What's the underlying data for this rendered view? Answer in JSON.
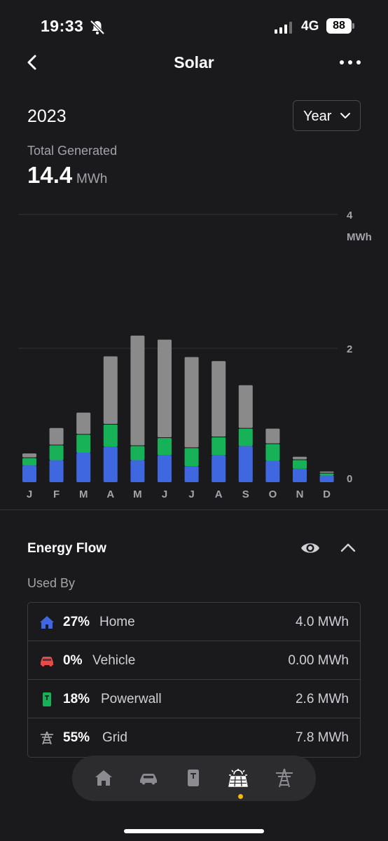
{
  "status_bar": {
    "time": "19:33",
    "network": "4G",
    "battery": "88"
  },
  "header": {
    "title": "Solar"
  },
  "summary": {
    "year": "2023",
    "period_select": "Year",
    "total_label": "Total Generated",
    "total_value": "14.4",
    "total_unit": "MWh"
  },
  "chart_data": {
    "type": "bar",
    "stacked": true,
    "categories": [
      "J",
      "F",
      "M",
      "A",
      "M",
      "J",
      "J",
      "A",
      "S",
      "O",
      "N",
      "D"
    ],
    "series": [
      {
        "color": "#3f68e0",
        "values": [
          0.25,
          0.33,
          0.44,
          0.53,
          0.33,
          0.4,
          0.24,
          0.4,
          0.54,
          0.32,
          0.2,
          0.1
        ]
      },
      {
        "color": "#17b158",
        "values": [
          0.12,
          0.23,
          0.28,
          0.34,
          0.22,
          0.27,
          0.28,
          0.28,
          0.27,
          0.26,
          0.14,
          0.04
        ]
      },
      {
        "color": "#8a8a8a",
        "values": [
          0.07,
          0.26,
          0.33,
          1.02,
          1.65,
          1.47,
          1.36,
          1.14,
          0.65,
          0.23,
          0.05,
          0.03
        ]
      }
    ],
    "y_ticks": [
      "0",
      "2",
      "4"
    ],
    "ylabel": "MWh",
    "ylim": [
      0,
      4
    ],
    "grid": true
  },
  "energy_flow": {
    "title": "Energy Flow",
    "used_by_label": "Used By",
    "rows": [
      {
        "pct": "27%",
        "name": "Home",
        "value": "4.0 MWh",
        "color": "#3f68e0",
        "icon": "home-icon"
      },
      {
        "pct": "0%",
        "name": "Vehicle",
        "value": "0.00 MWh",
        "color": "#e84a4a",
        "icon": "car-icon"
      },
      {
        "pct": "18%",
        "name": "Powerwall",
        "value": "2.6 MWh",
        "color": "#17b158",
        "icon": "powerwall-icon"
      },
      {
        "pct": "55%",
        "name": "Grid",
        "value": "7.8 MWh",
        "color": "#a0a0a0",
        "icon": "grid-tower-icon"
      }
    ]
  },
  "tab_bar": {
    "tabs": [
      "home-icon",
      "car-icon",
      "powerwall-icon",
      "solar-panel-icon",
      "grid-tower-icon"
    ],
    "active": "solar-panel-icon",
    "active_dot_color": "#f5b800"
  }
}
